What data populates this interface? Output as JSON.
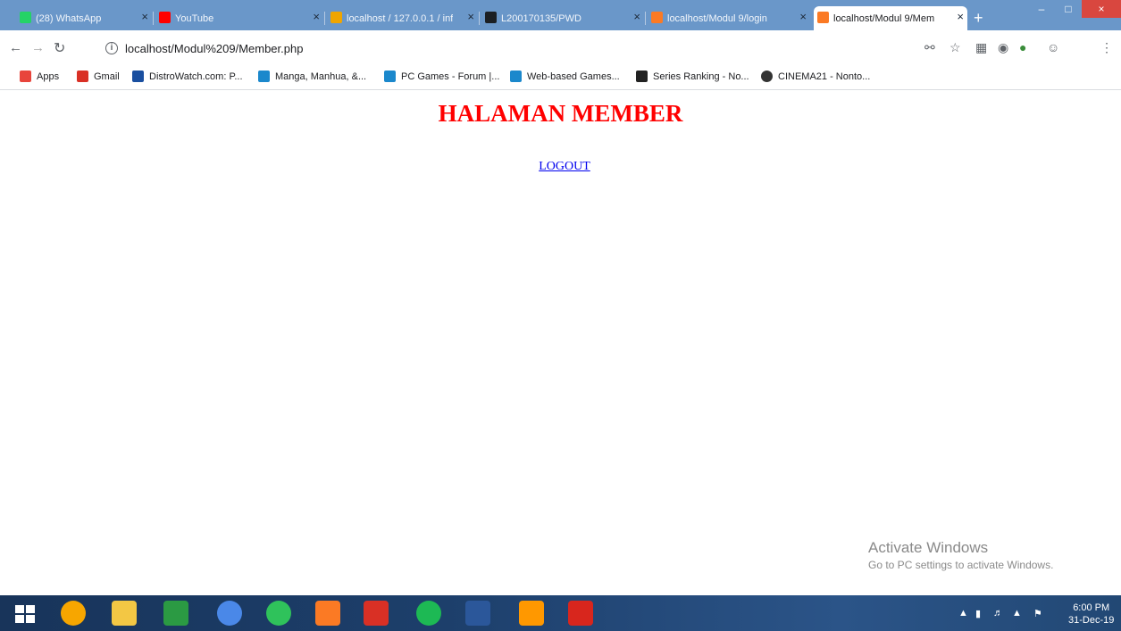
{
  "browser": {
    "tabs": [
      {
        "label": "(28) WhatsApp",
        "favicon": "whatsapp-icon",
        "color": "#25d366",
        "active": false
      },
      {
        "label": "YouTube",
        "favicon": "youtube-icon",
        "color": "#ff0000",
        "active": false
      },
      {
        "label": "localhost / 127.0.0.1 / inf",
        "favicon": "phpmyadmin-icon",
        "color": "#f0a500",
        "active": false
      },
      {
        "label": "L200170135/PWD",
        "favicon": "github-icon",
        "color": "#1b1f23",
        "active": false
      },
      {
        "label": "localhost/Modul 9/login",
        "favicon": "xampp-icon",
        "color": "#fb7a24",
        "active": false
      },
      {
        "label": "localhost/Modul 9/Mem",
        "favicon": "xampp-icon",
        "color": "#fb7a24",
        "active": true
      }
    ],
    "new_tab": "+",
    "minimize": "–",
    "maximize": "□",
    "close": "×",
    "url": "localhost/Modul%209/Member.php",
    "bookmarks": [
      {
        "label": "Apps",
        "icon": "apps-grid-icon",
        "color": "#e8453c"
      },
      {
        "label": "Gmail",
        "icon": "gmail-icon",
        "color": "#d93025"
      },
      {
        "label": "DistroWatch.com: P...",
        "icon": "distrowatch-icon",
        "color": "#1a4fa0"
      },
      {
        "label": "Manga, Manhua, &...",
        "icon": "kaskus-icon",
        "color": "#1b88cc"
      },
      {
        "label": "PC Games - Forum |...",
        "icon": "kaskus-icon",
        "color": "#1b88cc"
      },
      {
        "label": "Web-based Games...",
        "icon": "kaskus-icon",
        "color": "#1b88cc"
      },
      {
        "label": "Series Ranking - No...",
        "icon": "notion-icon",
        "color": "#222222"
      },
      {
        "label": "CINEMA21 - Nonto...",
        "icon": "cinema21-icon",
        "color": "#333333"
      }
    ]
  },
  "page": {
    "heading": "HALAMAN MEMBER",
    "logout_label": "LOGOUT",
    "heading_color": "#ff0000",
    "link_color": "#0000ee"
  },
  "watermark": {
    "title": "Activate Windows",
    "subtitle": "Go to PC settings to activate Windows."
  },
  "taskbar": {
    "apps": [
      {
        "name": "avast-icon",
        "color": "#f7a600"
      },
      {
        "name": "file-explorer-icon",
        "color": "#f3c744"
      },
      {
        "name": "store-icon",
        "color": "#2b9a43"
      },
      {
        "name": "chrome-icon",
        "color": "#4a88e8"
      },
      {
        "name": "whatsapp-icon",
        "color": "#2fc25b"
      },
      {
        "name": "xampp-icon",
        "color": "#fb7a24"
      },
      {
        "name": "game-icon",
        "color": "#d93025"
      },
      {
        "name": "spotify-icon",
        "color": "#1db954"
      },
      {
        "name": "word-icon",
        "color": "#2b579a"
      },
      {
        "name": "sublime-icon",
        "color": "#ff9800"
      },
      {
        "name": "acrobat-icon",
        "color": "#d8261d"
      }
    ],
    "time": "6:00 PM",
    "date": "31-Dec-19"
  }
}
